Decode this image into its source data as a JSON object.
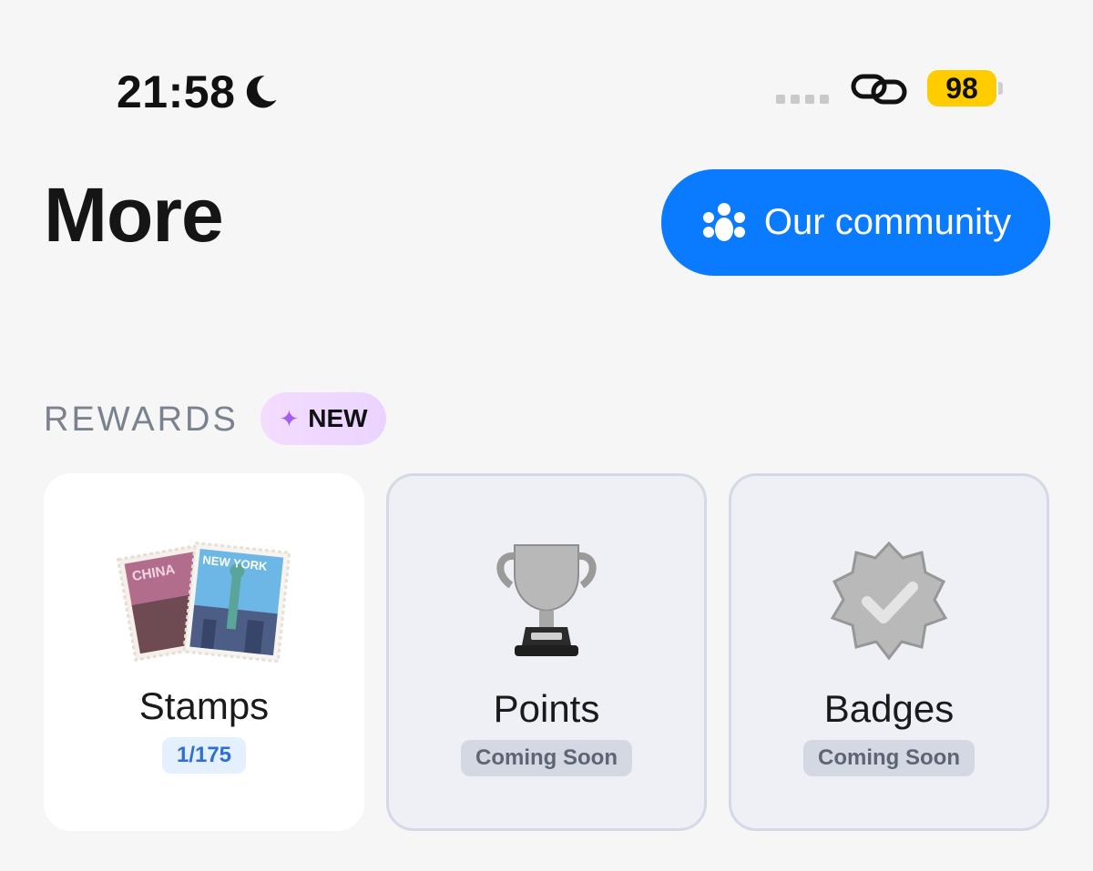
{
  "status_bar": {
    "time": "21:58",
    "battery": "98",
    "battery_color": "#ffcc00"
  },
  "header": {
    "title": "More",
    "community_button_label": "Our community",
    "accent": "#0a7aff"
  },
  "rewards": {
    "section_label": "REWARDS",
    "new_badge": "NEW",
    "cards": [
      {
        "title": "Stamps",
        "pill": "1/175",
        "icon": "stamps-icon",
        "available": true
      },
      {
        "title": "Points",
        "pill": "Coming Soon",
        "icon": "trophy-icon",
        "available": false
      },
      {
        "title": "Badges",
        "pill": "Coming Soon",
        "icon": "badge-icon",
        "available": false
      }
    ],
    "stamp_texts": {
      "left": "CHINA",
      "right": "NEW YORK"
    }
  }
}
